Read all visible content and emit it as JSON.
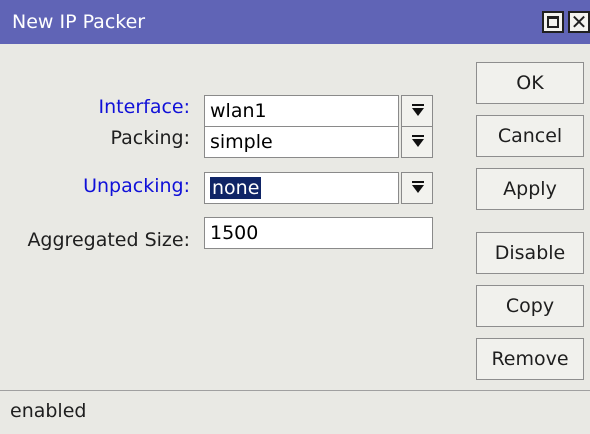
{
  "window": {
    "title": "New IP Packer"
  },
  "form": {
    "interface": {
      "label": "Interface:",
      "value": "wlan1"
    },
    "packing": {
      "label": "Packing:",
      "value": "simple"
    },
    "unpacking": {
      "label": "Unpacking:",
      "value": "none"
    },
    "aggregated_size": {
      "label": "Aggregated Size:",
      "value": "1500"
    }
  },
  "buttons": {
    "ok": "OK",
    "cancel": "Cancel",
    "apply": "Apply",
    "disable": "Disable",
    "copy": "Copy",
    "remove": "Remove"
  },
  "status": {
    "text": "enabled"
  },
  "icons": {
    "maximize": "maximize-icon",
    "close": "close-icon",
    "dropdown": "dropdown-arrow-icon"
  },
  "colors": {
    "titlebar": "#6064b6",
    "label_link": "#1010d8",
    "selection": "#0f2466"
  }
}
